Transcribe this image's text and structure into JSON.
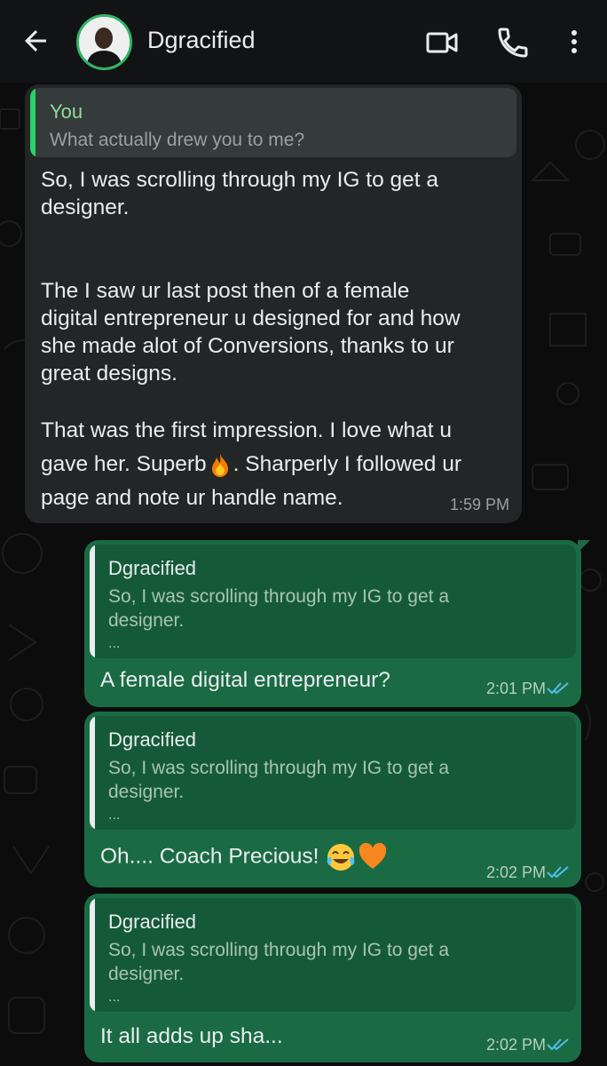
{
  "header": {
    "contact_name": "Dgracified",
    "icons": [
      "back-arrow-icon",
      "video-call-icon",
      "voice-call-icon",
      "more-options-icon"
    ]
  },
  "messages": {
    "incoming": {
      "quote_author": "You",
      "quote_text": "What actually drew you to me?",
      "para1_line1": "So, I was scrolling through my IG to get a",
      "para1_line2": "designer.",
      "para2_line1": "The I saw ur last post then of a female",
      "para2_line2": "digital entrepreneur u designed for and how",
      "para2_line3": "she made alot of Conversions, thanks to ur",
      "para2_line4": "great designs.",
      "para3_line1": "That was the first impression. I love what u",
      "para3_line2a": "gave her. Superb",
      "para3_line2b": ". Sharperly I followed ur",
      "para3_line3": "page and note ur handle name.",
      "time": "1:59 PM"
    },
    "out1": {
      "quote_author": "Dgracified",
      "quote_line1": "So, I was scrolling through my IG to get a",
      "quote_line2": "designer.",
      "quote_ellipsis": "...",
      "text": "A female digital entrepreneur?",
      "time": "2:01 PM"
    },
    "out2": {
      "quote_author": "Dgracified",
      "quote_line1": "So, I was scrolling through my IG to get a",
      "quote_line2": "designer.",
      "quote_ellipsis": "...",
      "text": "Oh.... Coach Precious!",
      "time": "2:02 PM"
    },
    "out3": {
      "quote_author": "Dgracified",
      "quote_line1": "So, I was scrolling through my IG to get a",
      "quote_line2": "designer.",
      "quote_ellipsis": "...",
      "text": "It all adds up sha...",
      "time": "2:02 PM"
    }
  },
  "colors": {
    "header_bg": "#111314",
    "incoming_bubble": "#232626",
    "outgoing_bubble": "#1a6b43",
    "read_ticks": "#53bdeb",
    "accent_green": "#25d366"
  }
}
